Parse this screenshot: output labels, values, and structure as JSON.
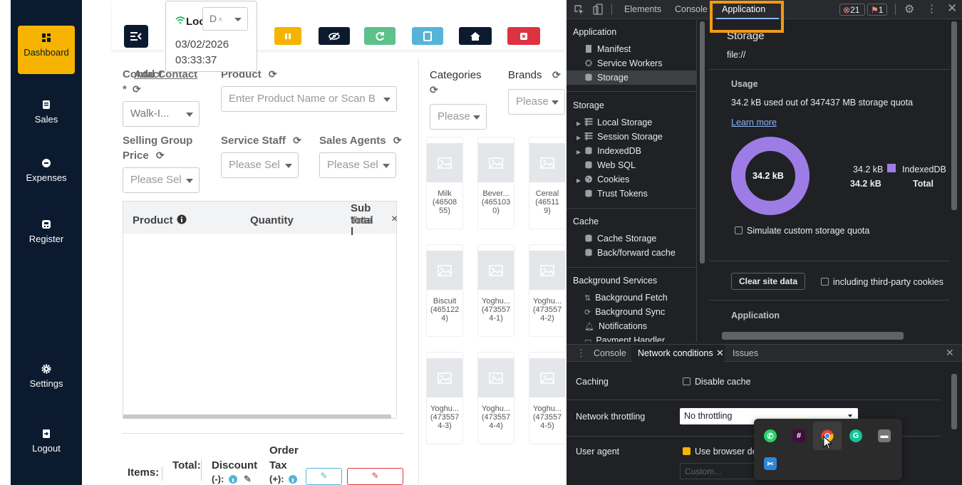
{
  "sidebar": {
    "items": [
      {
        "label": "Dashboard",
        "icon": "dashboard-icon"
      },
      {
        "label": "Sales",
        "icon": "receipt-icon"
      },
      {
        "label": "Expenses",
        "icon": "minus-circle-icon"
      },
      {
        "label": "Register",
        "icon": "register-icon"
      },
      {
        "label": "Settings",
        "icon": "gear-icon"
      },
      {
        "label": "Logout",
        "icon": "logout-icon"
      }
    ]
  },
  "topbar": {
    "location_label": "Loc",
    "location_select": "D",
    "date": "03/02/2026",
    "time": "03:33:37",
    "button_colors": {
      "pause": "#f6b400",
      "hide": "#0b1a2e",
      "refresh": "#5cc18a",
      "tablet": "#55b4d8",
      "home": "#0b1a2e",
      "close": "#dd3340"
    }
  },
  "form": {
    "contact_label": "Contact",
    "add_contact_label": "Add Contact",
    "required_mark": "*",
    "contact_value": "Walk-I...",
    "product_label": "Product",
    "product_placeholder": "Enter Product Name or Scan B",
    "selling_group_label_1": "Selling Group",
    "selling_group_label_2": "Price",
    "selling_group_placeholder": "Please Sel",
    "service_staff_label": "Service Staff",
    "service_staff_placeholder": "Please Sel",
    "sales_agents_label": "Sales Agents",
    "sales_agents_placeholder": "Please Sel"
  },
  "cart_table": {
    "col_product": "Product",
    "col_quantity": "Quantity",
    "col_subtotal_1": "Sub",
    "col_subtotal_2": "total",
    "col_subtotal_overlap": "Tota",
    "col_subtotal_3": "l",
    "close_glyph": "×"
  },
  "totals": {
    "items_label": "Items:",
    "total_label": "Total:",
    "discount_label": "Discount",
    "discount_suffix": "(-):",
    "order_label": "Order",
    "tax_label": "Tax",
    "tax_suffix": "(+):"
  },
  "catalog": {
    "categories_label": "Categories",
    "categories_placeholder": "Please",
    "brands_label": "Brands",
    "brands_placeholder": "Please",
    "products": [
      {
        "name": "Milk",
        "code_lines": [
          "(46508",
          "55)"
        ]
      },
      {
        "name": "Bever...",
        "code_lines": [
          "(465103",
          "0)"
        ]
      },
      {
        "name": "Cereal",
        "code_lines": [
          "(46511",
          "9)"
        ]
      },
      {
        "name": "Biscuit",
        "code_lines": [
          "(465122",
          "4)"
        ]
      },
      {
        "name": "Yoghu...",
        "code_lines": [
          "(473557",
          "4-1)"
        ]
      },
      {
        "name": "Yoghu...",
        "code_lines": [
          "(473557",
          "4-2)"
        ]
      },
      {
        "name": "Yoghu...",
        "code_lines": [
          "(473557",
          "4-3)"
        ]
      },
      {
        "name": "Yoghu...",
        "code_lines": [
          "(473557",
          "4-4)"
        ]
      },
      {
        "name": "Yoghu...",
        "code_lines": [
          "(473557",
          "4-5)"
        ]
      }
    ]
  },
  "devtools": {
    "tabs": [
      "Elements",
      "Console",
      "Application"
    ],
    "error_count": "21",
    "issue_count": "1",
    "tree": {
      "application_header": "Application",
      "application_items": [
        "Manifest",
        "Service Workers",
        "Storage"
      ],
      "storage_header": "Storage",
      "storage_items": [
        "Local Storage",
        "Session Storage",
        "IndexedDB",
        "Web SQL",
        "Cookies",
        "Trust Tokens"
      ],
      "cache_header": "Cache",
      "cache_items": [
        "Cache Storage",
        "Back/forward cache"
      ],
      "bg_header": "Background Services",
      "bg_items": [
        "Background Fetch",
        "Background Sync",
        "Notifications",
        "Payment Handler"
      ]
    },
    "storage_panel": {
      "title": "Storage",
      "origin": "file://",
      "usage_header": "Usage",
      "usage_text": "34.2 kB used out of 347437 MB storage quota",
      "learn_more": "Learn more",
      "donut_label": "34.2 kB",
      "legend_value": "34.2 kB",
      "legend_name": "IndexedDB",
      "total_value": "34.2 kB",
      "total_label": "Total",
      "simulate_label": "Simulate custom storage quota",
      "clear_button": "Clear site data",
      "third_party_label": "including third-party cookies",
      "application_header": "Application",
      "donut_color": "#9e7ce6"
    },
    "drawer": {
      "tabs": [
        "Console",
        "Network conditions",
        "Issues"
      ],
      "caching_label": "Caching",
      "disable_cache_label": "Disable cache",
      "throttling_label": "Network throttling",
      "throttling_value": "No throttling",
      "user_agent_label": "User agent",
      "use_browser_default": "Use browser de",
      "custom_placeholder": "Custom..."
    }
  },
  "tray": {
    "icons": [
      "whatsapp-icon",
      "slack-icon",
      "chrome-icon",
      "grammarly-icon",
      "display-icon",
      "snipping-tool-icon"
    ]
  }
}
